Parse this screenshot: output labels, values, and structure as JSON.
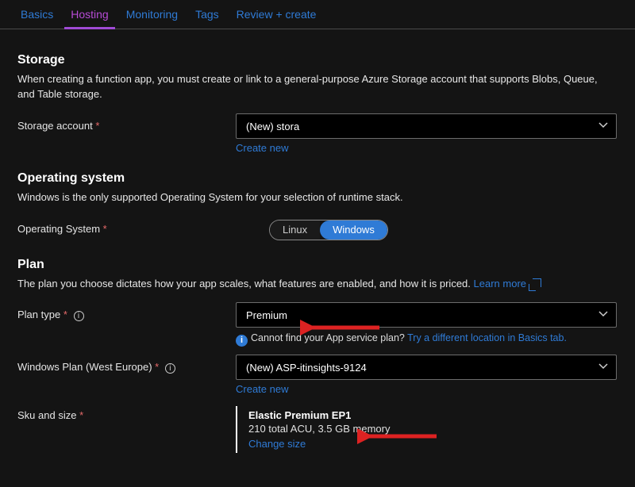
{
  "tabs": {
    "basics": "Basics",
    "hosting": "Hosting",
    "monitoring": "Monitoring",
    "tags": "Tags",
    "review": "Review + create"
  },
  "storage": {
    "heading": "Storage",
    "desc": "When creating a function app, you must create or link to a general-purpose Azure Storage account that supports Blobs, Queue, and Table storage.",
    "label": "Storage account",
    "select_value": "(New) stora",
    "create_new": "Create new"
  },
  "os": {
    "heading": "Operating system",
    "desc": "Windows is the only supported Operating System for your selection of runtime stack.",
    "label": "Operating System",
    "options": {
      "linux": "Linux",
      "windows": "Windows"
    }
  },
  "plan": {
    "heading": "Plan",
    "desc": "The plan you choose dictates how your app scales, what features are enabled, and how it is priced.",
    "learn_more": "Learn more",
    "type_label": "Plan type",
    "type_value": "Premium",
    "help_text": "Cannot find your App service plan?",
    "help_link": "Try a different location in Basics tab.",
    "winplan_label": "Windows Plan (West Europe)",
    "winplan_value": "(New) ASP-itinsights-9124",
    "create_new": "Create new",
    "sku_label": "Sku and size",
    "sku_title": "Elastic Premium EP1",
    "sku_sub": "210 total ACU, 3.5 GB memory",
    "sku_change": "Change size"
  }
}
